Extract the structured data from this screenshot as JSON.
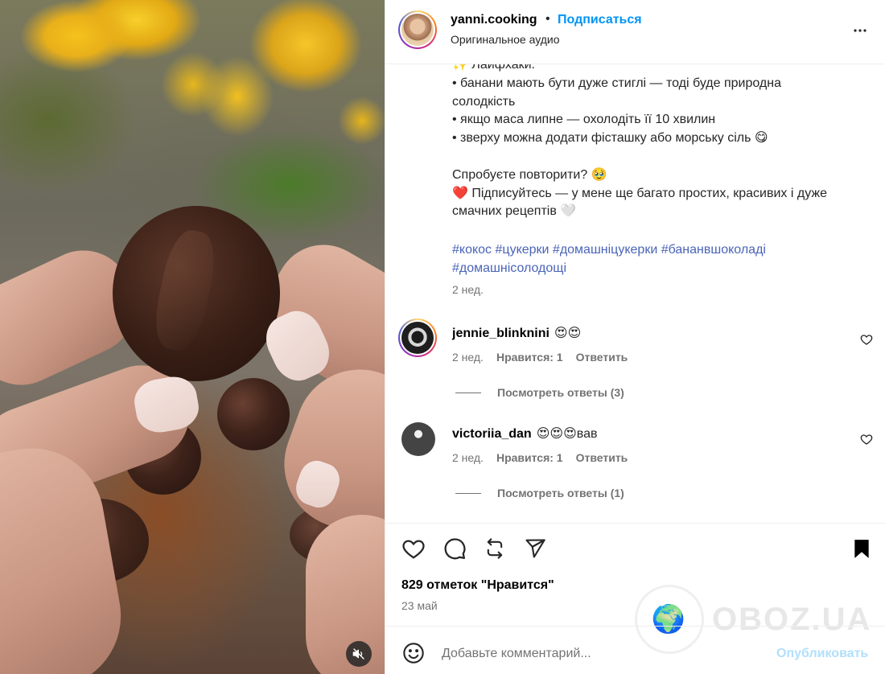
{
  "header": {
    "username": "yanni.cooking",
    "separator": "•",
    "follow_label": "Подписаться",
    "subtitle": "Оригинальное аудио",
    "more_icon": "more-horizontal-icon"
  },
  "caption": {
    "lines": [
      "✨ Лайфхаки:",
      "• банани мають бути дуже стиглі — тоді буде природна солодкість",
      "• якщо маса липне — охолодіть її 10 хвилин",
      "• зверху можна додати фісташку або морську сіль 😋",
      "",
      "Спробуєте повторити? 🥹",
      "❤️ Підписуйтесь — у мене ще багато простих, красивих і дуже смачних рецептів 🤍"
    ],
    "hashtags": [
      "#кокос",
      "#цукерки",
      "#домашніцукерки",
      "#бананвшоколаді",
      "#домашнісолодощі"
    ],
    "time": "2 нед."
  },
  "comments": [
    {
      "username": "jennie_blinknini",
      "text": "😍😍",
      "time": "2 нед.",
      "likes": "Нравится: 1",
      "reply_label": "Ответить",
      "view_replies": "Посмотреть ответы (3)"
    },
    {
      "username": "victoriia_dan",
      "text": "😍😍😍вав",
      "time": "2 нед.",
      "likes": "Нравится: 1",
      "reply_label": "Ответить",
      "view_replies": "Посмотреть ответы (1)"
    }
  ],
  "actions": {
    "icons": [
      "heart-icon",
      "comment-icon",
      "repost-icon",
      "share-icon",
      "bookmark-icon"
    ]
  },
  "likes_text": "829 отметок \"Нравится\"",
  "date": "23 май",
  "add_comment": {
    "placeholder": "Добавьте комментарий...",
    "post_label": "Опубликовать"
  },
  "watermark": {
    "text": "OBOZ.UA"
  },
  "colors": {
    "accent": "#0095f6",
    "hashtag": "#4a64b9",
    "muted": "#737373",
    "post_disabled": "#b2dffc"
  }
}
